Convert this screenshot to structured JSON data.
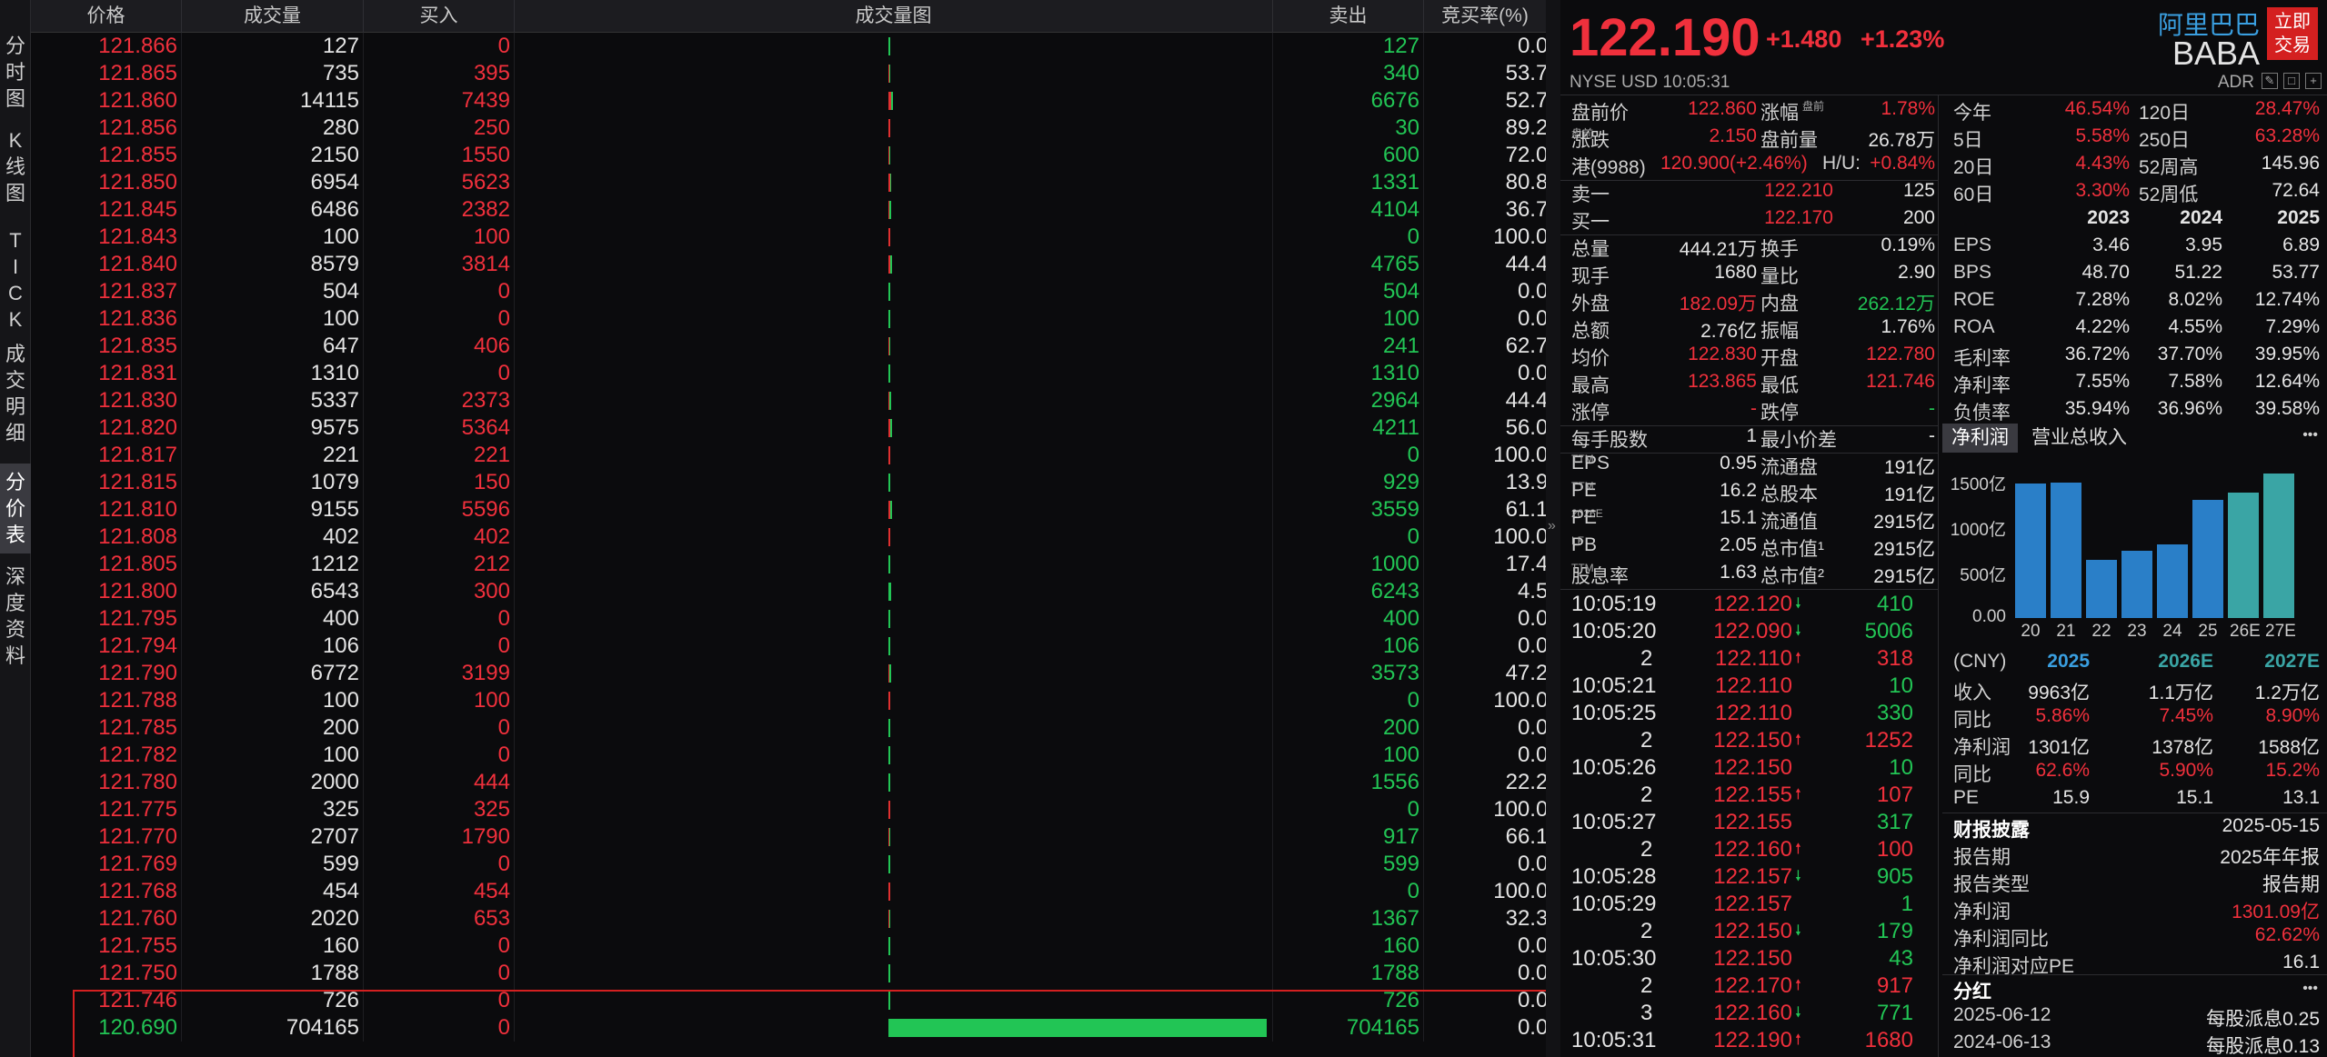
{
  "side_tabs": [
    "分\n时\n图",
    "K\n线\n图",
    "T\nI\nC\nK",
    "成\n交\n明\n细",
    "分\n价\n表",
    "深\n度\n资\n料"
  ],
  "active_side_tab": 4,
  "table": {
    "headers": {
      "price": "价格",
      "volume": "成交量",
      "buy": "买入",
      "chart": "成交量图",
      "sell": "卖出",
      "ratio": "竞买率(%)"
    },
    "rows": [
      {
        "price": "121.866",
        "vol": "127",
        "buy": "0",
        "sell": "127",
        "ratio": "0.000"
      },
      {
        "price": "121.865",
        "vol": "735",
        "buy": "395",
        "sell": "340",
        "ratio": "53.741"
      },
      {
        "price": "121.860",
        "vol": "14115",
        "buy": "7439",
        "sell": "6676",
        "ratio": "52.703"
      },
      {
        "price": "121.856",
        "vol": "280",
        "buy": "250",
        "sell": "30",
        "ratio": "89.286"
      },
      {
        "price": "121.855",
        "vol": "2150",
        "buy": "1550",
        "sell": "600",
        "ratio": "72.093"
      },
      {
        "price": "121.850",
        "vol": "6954",
        "buy": "5623",
        "sell": "1331",
        "ratio": "80.860"
      },
      {
        "price": "121.845",
        "vol": "6486",
        "buy": "2382",
        "sell": "4104",
        "ratio": "36.725"
      },
      {
        "price": "121.843",
        "vol": "100",
        "buy": "100",
        "sell": "0",
        "ratio": "100.000"
      },
      {
        "price": "121.840",
        "vol": "8579",
        "buy": "3814",
        "sell": "4765",
        "ratio": "44.457"
      },
      {
        "price": "121.837",
        "vol": "504",
        "buy": "0",
        "sell": "504",
        "ratio": "0.000"
      },
      {
        "price": "121.836",
        "vol": "100",
        "buy": "0",
        "sell": "100",
        "ratio": "0.000"
      },
      {
        "price": "121.835",
        "vol": "647",
        "buy": "406",
        "sell": "241",
        "ratio": "62.751"
      },
      {
        "price": "121.831",
        "vol": "1310",
        "buy": "0",
        "sell": "1310",
        "ratio": "0.000"
      },
      {
        "price": "121.830",
        "vol": "5337",
        "buy": "2373",
        "sell": "2964",
        "ratio": "44.463"
      },
      {
        "price": "121.820",
        "vol": "9575",
        "buy": "5364",
        "sell": "4211",
        "ratio": "56.021"
      },
      {
        "price": "121.817",
        "vol": "221",
        "buy": "221",
        "sell": "0",
        "ratio": "100.000"
      },
      {
        "price": "121.815",
        "vol": "1079",
        "buy": "150",
        "sell": "929",
        "ratio": "13.902"
      },
      {
        "price": "121.810",
        "vol": "9155",
        "buy": "5596",
        "sell": "3559",
        "ratio": "61.125"
      },
      {
        "price": "121.808",
        "vol": "402",
        "buy": "402",
        "sell": "0",
        "ratio": "100.000"
      },
      {
        "price": "121.805",
        "vol": "1212",
        "buy": "212",
        "sell": "1000",
        "ratio": "17.492"
      },
      {
        "price": "121.800",
        "vol": "6543",
        "buy": "300",
        "sell": "6243",
        "ratio": "4.585"
      },
      {
        "price": "121.795",
        "vol": "400",
        "buy": "0",
        "sell": "400",
        "ratio": "0.000"
      },
      {
        "price": "121.794",
        "vol": "106",
        "buy": "0",
        "sell": "106",
        "ratio": "0.000"
      },
      {
        "price": "121.790",
        "vol": "6772",
        "buy": "3199",
        "sell": "3573",
        "ratio": "47.239"
      },
      {
        "price": "121.788",
        "vol": "100",
        "buy": "100",
        "sell": "0",
        "ratio": "100.000"
      },
      {
        "price": "121.785",
        "vol": "200",
        "buy": "0",
        "sell": "200",
        "ratio": "0.000"
      },
      {
        "price": "121.782",
        "vol": "100",
        "buy": "0",
        "sell": "100",
        "ratio": "0.000"
      },
      {
        "price": "121.780",
        "vol": "2000",
        "buy": "444",
        "sell": "1556",
        "ratio": "22.200"
      },
      {
        "price": "121.775",
        "vol": "325",
        "buy": "325",
        "sell": "0",
        "ratio": "100.000"
      },
      {
        "price": "121.770",
        "vol": "2707",
        "buy": "1790",
        "sell": "917",
        "ratio": "66.125"
      },
      {
        "price": "121.769",
        "vol": "599",
        "buy": "0",
        "sell": "599",
        "ratio": "0.000"
      },
      {
        "price": "121.768",
        "vol": "454",
        "buy": "454",
        "sell": "0",
        "ratio": "100.000"
      },
      {
        "price": "121.760",
        "vol": "2020",
        "buy": "653",
        "sell": "1367",
        "ratio": "32.327"
      },
      {
        "price": "121.755",
        "vol": "160",
        "buy": "0",
        "sell": "160",
        "ratio": "0.000"
      },
      {
        "price": "121.750",
        "vol": "1788",
        "buy": "0",
        "sell": "1788",
        "ratio": "0.000"
      },
      {
        "price": "121.746",
        "vol": "726",
        "buy": "0",
        "sell": "726",
        "ratio": "0.000"
      },
      {
        "price": "120.690",
        "vol": "704165",
        "buy": "0",
        "sell": "704165",
        "ratio": "0.000",
        "price_color": "green"
      }
    ]
  },
  "quote": {
    "price": "122.190",
    "change": "+1.480",
    "change_pct": "+1.23%",
    "company": "阿里巴巴",
    "ticker": "BABA",
    "trade_button": "立即\n交易",
    "market": "NYSE  USD  10:05:31",
    "adr": "ADR"
  },
  "stats_left": [
    {
      "l1": "盘前价",
      "v1": "122.860",
      "c1": "red",
      "l2": "涨幅",
      "s2": "盘前",
      "v2": "1.78%",
      "c2": "red"
    },
    {
      "l1": "涨跌",
      "s1": "盘前",
      "v1": "2.150",
      "c1": "red",
      "l2": "盘前量",
      "v2": "26.78万",
      "c2": "white"
    },
    {
      "l1": "港(9988)",
      "v1": "120.900(+2.46%)",
      "c1": "red",
      "l2": "H/U:",
      "v2": "+0.84%",
      "c2": "red",
      "special": true
    },
    {
      "l1": "卖一",
      "v1": "122.210",
      "c1": "red",
      "v2": "125",
      "c2": "white",
      "single": true
    },
    {
      "l1": "买一",
      "v1": "122.170",
      "c1": "red",
      "v2": "200",
      "c2": "white",
      "single": true
    },
    {
      "l1": "总量",
      "v1": "444.21万",
      "c1": "white",
      "l2": "换手",
      "v2": "0.19%",
      "c2": "white"
    },
    {
      "l1": "现手",
      "v1": "1680",
      "c1": "white",
      "l2": "量比",
      "v2": "2.90",
      "c2": "white"
    },
    {
      "l1": "外盘",
      "v1": "182.09万",
      "c1": "red",
      "l2": "内盘",
      "v2": "262.12万",
      "c2": "green"
    },
    {
      "l1": "总额",
      "v1": "2.76亿",
      "c1": "white",
      "l2": "振幅",
      "v2": "1.76%",
      "c2": "white"
    },
    {
      "l1": "均价",
      "v1": "122.830",
      "c1": "red",
      "l2": "开盘",
      "v2": "122.780",
      "c2": "red"
    },
    {
      "l1": "最高",
      "v1": "123.865",
      "c1": "red",
      "l2": "最低",
      "v2": "121.746",
      "c2": "red"
    },
    {
      "l1": "涨停",
      "v1": "-",
      "c1": "red",
      "l2": "跌停",
      "v2": "-",
      "c2": "green"
    },
    {
      "l1": "每手股数",
      "v1": "1",
      "c1": "white",
      "l2": "最小价差",
      "v2": "-",
      "c2": "white"
    },
    {
      "l1": "EPS",
      "s1": "TTM",
      "v1": "0.95",
      "c1": "white",
      "l2": "流通盘",
      "v2": "191亿",
      "c2": "white"
    },
    {
      "l1": "PE",
      "s1": "TTM",
      "v1": "16.2",
      "c1": "white",
      "l2": "总股本",
      "v2": "191亿",
      "c2": "white"
    },
    {
      "l1": "PE",
      "s1": "2026E",
      "v1": "15.1",
      "c1": "white",
      "l2": "流通值",
      "v2": "2915亿",
      "c2": "white"
    },
    {
      "l1": "PB",
      "s1": "LF",
      "v1": "2.05",
      "c1": "white",
      "l2": "总市值¹",
      "v2": "2915亿",
      "c2": "white"
    },
    {
      "l1": "股息率",
      "s1": "TTM",
      "v1": "1.63",
      "c1": "white",
      "l2": "总市值²",
      "v2": "2915亿",
      "c2": "white"
    }
  ],
  "stats_right": [
    {
      "l1": "今年",
      "v1": "46.54%",
      "c1": "red",
      "l2": "120日",
      "v2": "28.47%",
      "c2": "red"
    },
    {
      "l1": "5日",
      "v1": "5.58%",
      "c1": "red",
      "l2": "250日",
      "v2": "63.28%",
      "c2": "red"
    },
    {
      "l1": "20日",
      "v1": "4.43%",
      "c1": "red",
      "l2": "52周高",
      "v2": "145.96",
      "c2": "white"
    },
    {
      "l1": "60日",
      "v1": "3.30%",
      "c1": "red",
      "l2": "52周低",
      "v2": "72.64",
      "c2": "white"
    }
  ],
  "fin": {
    "years": [
      "2023",
      "2024",
      "2025"
    ],
    "rows": [
      {
        "label": "EPS",
        "vals": [
          "3.46",
          "3.95",
          "6.89"
        ],
        "color": "white"
      },
      {
        "label": "BPS",
        "vals": [
          "48.70",
          "51.22",
          "53.77"
        ],
        "color": "white"
      },
      {
        "label": "ROE",
        "vals": [
          "7.28%",
          "8.02%",
          "12.74%"
        ],
        "color": "white"
      },
      {
        "label": "ROA",
        "vals": [
          "4.22%",
          "4.55%",
          "7.29%"
        ],
        "color": "white"
      },
      {
        "label": "毛利率",
        "vals": [
          "36.72%",
          "37.70%",
          "39.95%"
        ],
        "color": "white"
      },
      {
        "label": "净利率",
        "vals": [
          "7.55%",
          "7.58%",
          "12.64%"
        ],
        "color": "white"
      },
      {
        "label": "负债率",
        "vals": [
          "35.94%",
          "36.96%",
          "39.58%"
        ],
        "color": "white"
      }
    ]
  },
  "mini_tabs": [
    "净利润",
    "营业总收入"
  ],
  "more": "•••",
  "chart_data": {
    "type": "bar",
    "categories": [
      "20",
      "21",
      "22",
      "23",
      "24",
      "25",
      "26E",
      "27E"
    ],
    "values": [
      1480,
      1490,
      640,
      740,
      810,
      1301,
      1378,
      1588
    ],
    "estimate_from_index": 6,
    "yticks": [
      "1500亿",
      "1000亿",
      "500亿",
      "0.00"
    ],
    "ylim": [
      0,
      1650
    ],
    "colors": {
      "actual": "#2a7fc8",
      "estimate": "#3aa5a5"
    }
  },
  "forecast": {
    "header": [
      "(CNY)",
      "2025",
      "2026E",
      "2027E"
    ],
    "rows": [
      {
        "label": "收入",
        "vals": [
          "9963亿",
          "1.1万亿",
          "1.2万亿"
        ],
        "color": "white"
      },
      {
        "label": "同比",
        "vals": [
          "5.86%",
          "7.45%",
          "8.90%"
        ],
        "color": "red"
      },
      {
        "label": "净利润",
        "vals": [
          "1301亿",
          "1378亿",
          "1588亿"
        ],
        "color": "white"
      },
      {
        "label": "同比",
        "vals": [
          "62.6%",
          "5.90%",
          "15.2%"
        ],
        "color": "red"
      },
      {
        "label": "PE",
        "vals": [
          "15.9",
          "15.1",
          "13.1"
        ],
        "color": "white"
      }
    ]
  },
  "disclosure": {
    "title": "财报披露",
    "date": "2025-05-15",
    "rows": [
      {
        "label": "报告期",
        "val": "2025年年报",
        "color": "white"
      },
      {
        "label": "报告类型",
        "val": "报告期",
        "color": "white"
      },
      {
        "label": "净利润",
        "val": "1301.09亿",
        "color": "red"
      },
      {
        "label": "净利润同比",
        "val": "62.62%",
        "color": "red"
      },
      {
        "label": "净利润对应PE",
        "val": "16.1",
        "color": "white"
      }
    ]
  },
  "dividend": {
    "title": "分红",
    "rows": [
      {
        "date": "2025-06-12",
        "text": "每股派息0.25"
      },
      {
        "date": "2024-06-13",
        "text": "每股派息0.13"
      }
    ]
  },
  "ticks": [
    {
      "t": "10:05:19",
      "p": "122.120",
      "dir": "down",
      "q": "410",
      "pc": "red"
    },
    {
      "t": "10:05:20",
      "p": "122.090",
      "dir": "down",
      "q": "5006",
      "pc": "red"
    },
    {
      "t": "2",
      "p": "122.110",
      "dir": "up",
      "q": "318",
      "pc": "red",
      "sub": true
    },
    {
      "t": "10:05:21",
      "p": "122.110",
      "dir": "",
      "q": "10",
      "pc": "red"
    },
    {
      "t": "10:05:25",
      "p": "122.110",
      "dir": "",
      "q": "330",
      "pc": "red"
    },
    {
      "t": "2",
      "p": "122.150",
      "dir": "up",
      "q": "1252",
      "pc": "red",
      "sub": true
    },
    {
      "t": "10:05:26",
      "p": "122.150",
      "dir": "",
      "q": "10",
      "pc": "red"
    },
    {
      "t": "2",
      "p": "122.155",
      "dir": "up",
      "q": "107",
      "pc": "red",
      "sub": true
    },
    {
      "t": "10:05:27",
      "p": "122.155",
      "dir": "",
      "q": "317",
      "pc": "red"
    },
    {
      "t": "2",
      "p": "122.160",
      "dir": "up",
      "q": "100",
      "pc": "red",
      "sub": true
    },
    {
      "t": "10:05:28",
      "p": "122.157",
      "dir": "down",
      "q": "905",
      "pc": "red"
    },
    {
      "t": "10:05:29",
      "p": "122.157",
      "dir": "",
      "q": "1",
      "pc": "red"
    },
    {
      "t": "2",
      "p": "122.150",
      "dir": "down",
      "q": "179",
      "pc": "red",
      "sub": true
    },
    {
      "t": "10:05:30",
      "p": "122.150",
      "dir": "",
      "q": "43",
      "pc": "red"
    },
    {
      "t": "2",
      "p": "122.170",
      "dir": "up",
      "q": "917",
      "pc": "red",
      "sub": true
    },
    {
      "t": "3",
      "p": "122.160",
      "dir": "down",
      "q": "771",
      "pc": "red",
      "sub": true
    },
    {
      "t": "10:05:31",
      "p": "122.190",
      "dir": "up",
      "q": "1680",
      "pc": "red"
    }
  ]
}
